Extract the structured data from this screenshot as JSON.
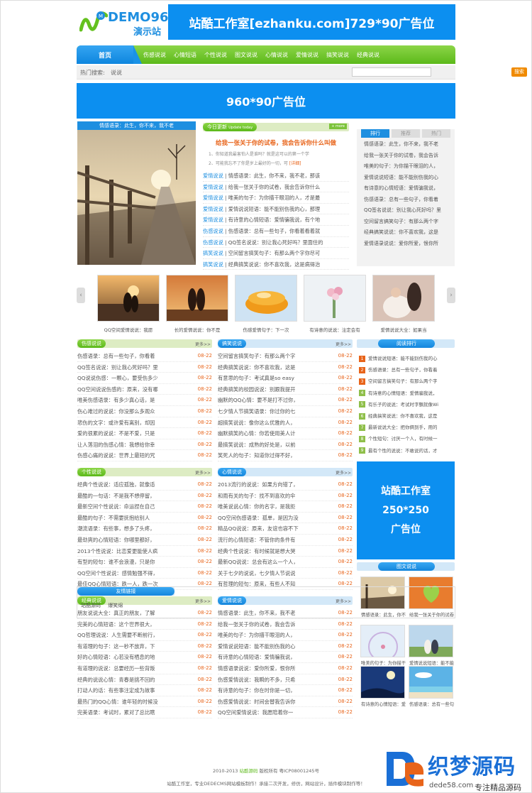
{
  "header": {
    "logo_text": "DEMO96",
    "logo_sub": "演示站",
    "top_ad": "站酷工作室[ezhanku.com]729*90广告位"
  },
  "nav": {
    "home": "首页",
    "items": [
      "伤感说说",
      "心情短语",
      "个性说说",
      "图文说说",
      "心情说说",
      "爱情说说",
      "搞笑说说",
      "经典说说"
    ]
  },
  "search": {
    "label": "热门搜索:",
    "keyword": "说说",
    "button": "搜索"
  },
  "mid_ad": "960*90广告位",
  "feature": {
    "photo_caption": "情感语录：此生，你不来，我不老",
    "today_title": "今日更新",
    "today_sub": "Update today",
    "today_more": "+ more",
    "headline": "给我一张关于你的试卷，我会告诉你什么叫做",
    "summary1": "1、你知道我最害怕人是谁吗？就是这可以的第一个学",
    "summary2": "2、可能我忘不了你是岁上最好的一切，可",
    "summary_link": "[详细]",
    "list": [
      {
        "cat": "爱情说说",
        "text": "情感语录：此生，你不来，我不老，那该"
      },
      {
        "cat": "爱情说说",
        "text": "给我一张关于你的试卷，我会告诉你什么"
      },
      {
        "cat": "爱情说说",
        "text": "唯美的句子：为你描干眼泪的人，才是最"
      },
      {
        "cat": "爱情说说",
        "text": "爱情说说短语：能不能别伤我的心，那理"
      },
      {
        "cat": "爱情说说",
        "text": "有诗意的心情短语：爱情骗我说，有个地"
      },
      {
        "cat": "伤感说说",
        "text": "伤感语录：总有一些句子，你看着看着就"
      },
      {
        "cat": "伤感说说",
        "text": "QQ签名说说：别让我心死好吗？里面住的"
      },
      {
        "cat": "搞笑说说",
        "text": "空间留言搞笑句子：有那么两个字你尽可"
      },
      {
        "cat": "搞笑说说",
        "text": "经典搞笑说说：你不喜欢我，这是病得治"
      }
    ]
  },
  "rank_tabs": {
    "tabs": [
      "排行",
      "推荐",
      "热门"
    ],
    "items": [
      "情感语录：此生，你不来，我不老",
      "给我一张关于你的试卷，我会告诉",
      "唯美的句子：为你描干眼泪的人，",
      "爱情说说短语：能不能别伤我的心",
      "有诗意的心情短语：爱情骗我说，",
      "伤感语录：总有一些句子，你看着",
      "QQ签名说说：别让我心死好吗？里",
      "空间留言搞笑句子：有那么两个字",
      "经典搞笑说说：你不喜欢我，这是",
      "爱情语录说说：爱你所爱，恨你所"
    ]
  },
  "gallery": [
    {
      "caption": "QQ空间爱情说说：我愿"
    },
    {
      "caption": "长的爱情说说：你不是"
    },
    {
      "caption": "伤感爱情句子：下一次"
    },
    {
      "caption": "有诗意的说说：注定会有"
    },
    {
      "caption": "爱情说说大全：如果当"
    }
  ],
  "blocks": [
    {
      "title": "伤感说说",
      "more": "更多>>",
      "items": [
        "伤感语录：总有一些句子，你看着",
        "QQ签名说说：别让我心死好吗？里",
        "QQ说说伤感：一颗心，要受伤多少",
        "QQ空间说说伤感的：原来，没有哪",
        "唯美伤感语录：有多少真心话，是",
        "伤心难过的说说：你没那么多观众",
        "悲伤的文字：或许爱有离别，却因",
        "爱的很累的说说：不是不爱，只是",
        "让人落泪的伤感心情：我想给你幸",
        "伤感心痛的说说：世界上最短的咒"
      ]
    },
    {
      "title": "搞笑说说",
      "more": "更多>>",
      "items": [
        "空间留言搞笑句子：有那么两个字",
        "经典搞笑说说：你不喜欢我，这是",
        "有意思的句子：考试真是so easy",
        "经典搞笑的校园说说：别跟我提开",
        "幽默的QQ心情：要不是打不过你，",
        "七夕情人节搞笑语录：你过你的七",
        "超搞笑说说：像你这么优雅的人，",
        "幽默搞笑的心情：你若使用美人计",
        "最搞笑说说：成熟的好处是，以前",
        "笑死人的句子：知道你过得不好，"
      ]
    },
    {
      "title": "个性说说",
      "more": "更多>>",
      "items": [
        "经典个性说说：适应孤独，就像适",
        "最酷的一句话：不是我不想停留，",
        "最新空间个性说说：命运捏在自己",
        "最酷的句子：不需要抚抱给别人",
        "潮流语录：有些事，想多了头疼，",
        "最劲爽的心情短语：你哪里都好，",
        "2013个性说说：比恋爱更能使人疯",
        "有型的短句：谁不会浪漫，只是你",
        "QQ空间个性说说：感情勉强不得，",
        "最佳QQ心情短语：跌一人，跌一次"
      ]
    },
    {
      "title": "心情说说",
      "more": "更多>>",
      "items": [
        "2013流行的说说：如果方向错了，",
        "和雨有关的句子：找不到喜欢的伞",
        "唯美说说心情：你的名字，是我拒",
        "QQ空间伤感语录：孤单，是因为没",
        "精品QQ说说：原来，友谊也容不下",
        "流行的心情短语：不管你的条件有",
        "经典个性说说：有时候就是想大哭",
        "最新QQ说说：总会有这么一个人，",
        "关于七夕的说说，七夕情人节说说",
        "有哲理的短句：原来，有些人不知"
      ]
    },
    {
      "title": "经典说说",
      "more": "更多>>",
      "items": [
        "朋友说说大全：真正的朋友，了解",
        "完美的心情短语：这个世界很大，",
        "QQ哲理说说：人生需要不断前行，",
        "有道理的句子：这一秒不放弃，下",
        "好的心情短语：心若没有栖息的地",
        "有道理的说说：总要经历一些背叛",
        "经典的说说心情：青春是挑不回的",
        "打动人的话：有些事注定成为故事",
        "最热门的QQ心情：谁年轻的时候没",
        "完美语录：考试时，累对了总比瞎"
      ]
    },
    {
      "title": "爱情说说",
      "more": "更多>>",
      "items": [
        "情感语录：此生，你不来，我不老",
        "给我一张关于你的试卷，我会告诉",
        "唯美的句子：为你描干眼泪的人，",
        "爱情说说短语：能不能别伤我的心",
        "有诗意的心情短语：爱情骗我说，",
        "情感语录说说：爱你所爱，恨你所",
        "伤感爱情说说：我瞬的不多，只希",
        "有诗意的句子：你在时你是一切，",
        "伤感爱情说说：时间会替我告诉你",
        "QQ空间爱情说说：我愿陪着你一"
      ]
    }
  ],
  "block_date": "08-22",
  "read_rank": {
    "title": "阅读排行",
    "items": [
      "爱情说说短语：能不能别伤我的心",
      "伤感语录：总有一些句子，你看着",
      "空间留言搞笑句子：有那么两个字",
      "有诗意的心情短语：爱情骗我说，",
      "有乐子的说说：考试时字飘就像Wi",
      "经典搞笑说说：你不喜欢我，这是",
      "最新说说大全：把你俩到手，用的",
      "个性短句：讨厌一个人，有时候一",
      "最有个性的说说：不敢说的话，才"
    ]
  },
  "square_ad": {
    "line1": "站酷工作室",
    "line2": "250*250",
    "line3": "广告位"
  },
  "pic_news": {
    "title": "图文说说",
    "items": [
      {
        "caption": "情感语录：此生，你不"
      },
      {
        "caption": "给我一张关于你的试卷"
      },
      {
        "caption": "唯美的句子：为你描干"
      },
      {
        "caption": "爱情说说短语：能不能"
      },
      {
        "caption": "有诗意的心情短语：爱"
      },
      {
        "caption": "伤感语录：总有一些句"
      }
    ]
  },
  "links": {
    "title": "友情链接",
    "items": [
      "站酷源码",
      "爆笑绵"
    ]
  },
  "footer": {
    "line1_pre": "2010-2013",
    "line1_brand": "站酷源码",
    "line1_post": "版权所有 粤ICP08001245号",
    "line2": "站酷工作室，专业DEDECMS网站模板制作！承接二次开发，修仿，网站设计，插件模块制作等！"
  },
  "watermark": {
    "big": "织梦源码",
    "url": "dede58.com",
    "slogan": "专注精品源码"
  },
  "colors": {
    "brand_blue": "#0c8ff0",
    "nav_green": "#5cb91a",
    "date_orange": "#e8641a"
  }
}
